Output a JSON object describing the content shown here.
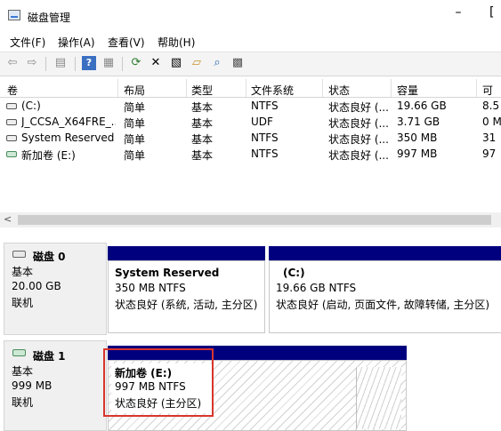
{
  "window": {
    "title": "磁盘管理",
    "minimize_glyph": "–",
    "restore_glyph": "["
  },
  "menu": {
    "file": "文件(F)",
    "action": "操作(A)",
    "view": "查看(V)",
    "help": "帮助(H)"
  },
  "toolbar": {
    "icons": [
      "back-icon",
      "forward-icon",
      "console-tree-icon",
      "help-icon",
      "properties-icon",
      "refresh-icon",
      "delete-icon",
      "format-icon",
      "open-icon",
      "explore-icon",
      "settings-icon"
    ]
  },
  "volume_list": {
    "columns": [
      "卷",
      "布局",
      "类型",
      "文件系统",
      "状态",
      "容量",
      "可"
    ],
    "rows": [
      [
        "(C:)",
        "简单",
        "基本",
        "NTFS",
        "状态良好 (...",
        "19.66 GB",
        "8.5"
      ],
      [
        "J_CCSA_X64FRE_...",
        "简单",
        "基本",
        "UDF",
        "状态良好 (...",
        "3.71 GB",
        "0 M"
      ],
      [
        "System Reserved",
        "简单",
        "基本",
        "NTFS",
        "状态良好 (...",
        "350 MB",
        "31"
      ],
      [
        "新加卷 (E:)",
        "简单",
        "基本",
        "NTFS",
        "状态良好 (...",
        "997 MB",
        "97"
      ]
    ],
    "scroll_left_glyph": "<"
  },
  "disks": [
    {
      "name": "磁盘 0",
      "type": "基本",
      "size": "20.00 GB",
      "status": "联机",
      "partitions": [
        {
          "name": "System Reserved",
          "size": "350 MB NTFS",
          "status": "状态良好 (系统, 活动, 主分区)"
        },
        {
          "name": "(C:)",
          "size": "19.66 GB NTFS",
          "status": "状态良好 (启动, 页面文件, 故障转储, 主分区)"
        }
      ]
    },
    {
      "name": "磁盘 1",
      "type": "基本",
      "size": "999 MB",
      "status": "联机",
      "partitions": [
        {
          "name": "新加卷  (E:)",
          "size": "997 MB NTFS",
          "status": "状态良好 (主分区)"
        }
      ]
    }
  ],
  "colors": {
    "partition_bar": "#00007f",
    "selection": "#d9352c"
  }
}
